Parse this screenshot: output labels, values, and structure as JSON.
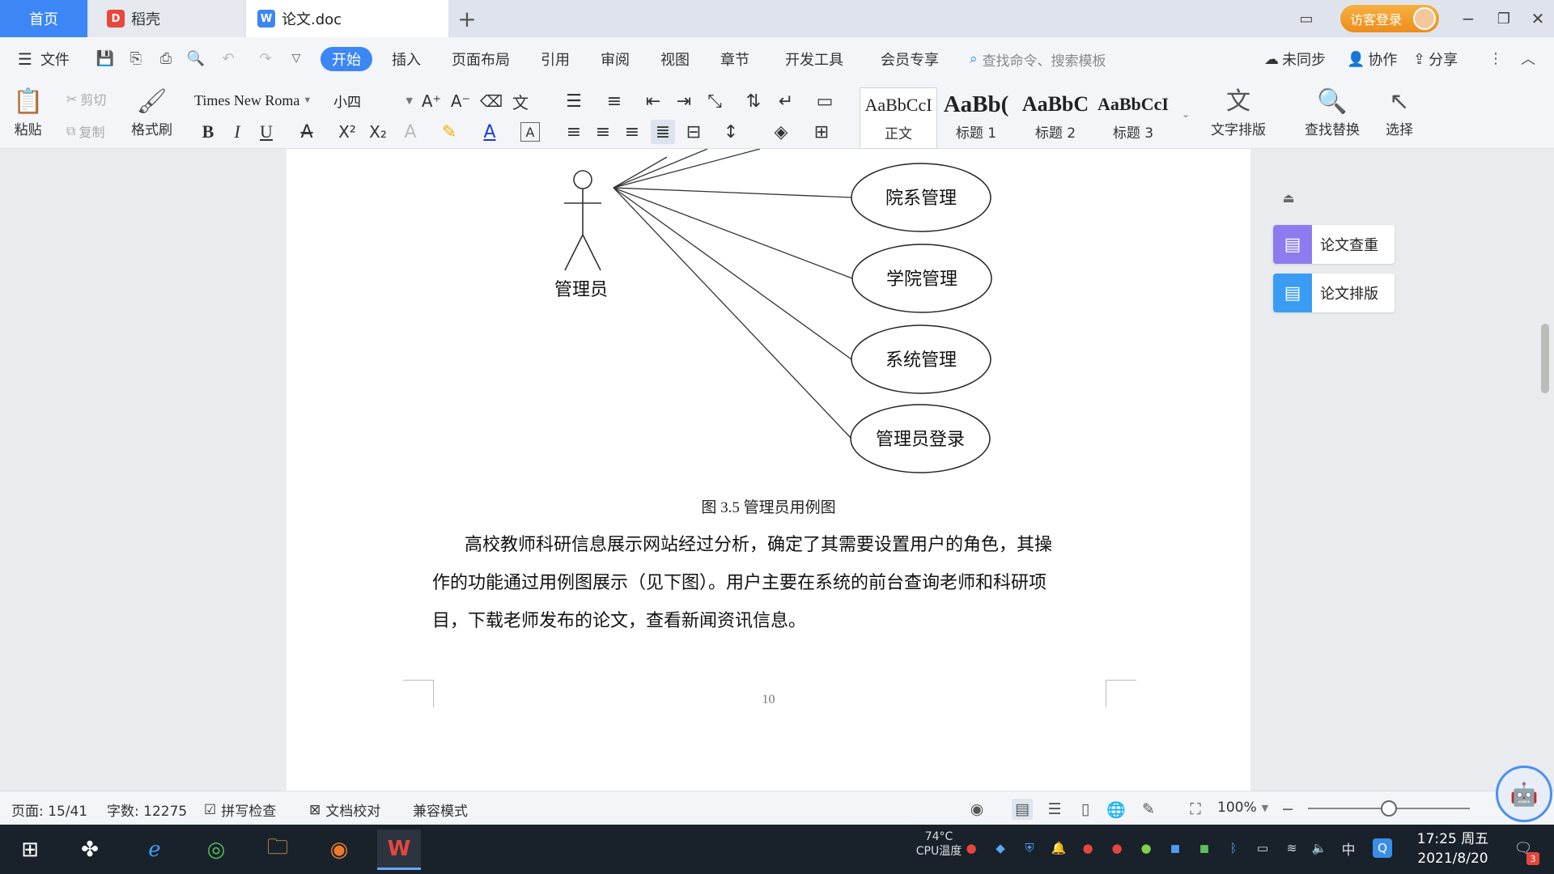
{
  "tabs": {
    "home": "首页",
    "daoke": "稻壳",
    "doc": "论文.doc",
    "new_tab": "+"
  },
  "window": {
    "login": "访客登录",
    "minimize": "−",
    "restore": "❐",
    "close": "✕"
  },
  "menu": {
    "file": "文件",
    "items": [
      "开始",
      "插入",
      "页面布局",
      "引用",
      "审阅",
      "视图",
      "章节",
      "开发工具",
      "会员专享"
    ],
    "search_placeholder": "查找命令、搜索模板",
    "sync": "未同步",
    "collab": "协作",
    "share": "分享"
  },
  "ribbon": {
    "paste": "粘贴",
    "cut": "剪切",
    "copy": "复制",
    "format_painter": "格式刷",
    "font_name": "Times New Roma",
    "font_size": "小四",
    "styles": [
      {
        "preview": "AaBbCcI",
        "label": "正文"
      },
      {
        "preview": "AaBb(",
        "label": "标题 1"
      },
      {
        "preview": "AaBbC",
        "label": "标题 2"
      },
      {
        "preview": "AaBbCcI",
        "label": "标题 3"
      }
    ],
    "text_layout": "文字排版",
    "find_replace": "查找替换",
    "select": "选择"
  },
  "document": {
    "diagram": {
      "actor": "管理员",
      "use_cases": [
        "院系管理",
        "学院管理",
        "系统管理",
        "管理员登录"
      ]
    },
    "caption": "图 3.5  管理员用例图",
    "paragraph_lines": [
      "高校教师科研信息展示网站经过分析，确定了其需要设置用户的角色，其操",
      "作的功能通过用例图展示（见下图）。用户主要在系统的前台查询老师和科研项",
      "目，下载老师发布的论文，查看新闻资讯信息。"
    ],
    "page_number": "10"
  },
  "side_panel": {
    "check": "论文查重",
    "layout": "论文排版"
  },
  "status": {
    "page": "页面: 15/41",
    "words": "字数: 12275",
    "spell": "拼写检查",
    "proof": "文档校对",
    "compat": "兼容模式",
    "zoom": "100%"
  },
  "taskbar": {
    "cpu_temp": "74°C",
    "cpu_label": "CPU温度",
    "ime": "中",
    "time": "17:25 周五",
    "date": "2021/8/20",
    "notif_count": "3"
  },
  "colors": {
    "accent": "#3c86f6",
    "login": "#ec8d1c",
    "taskbar": "#19212b"
  }
}
